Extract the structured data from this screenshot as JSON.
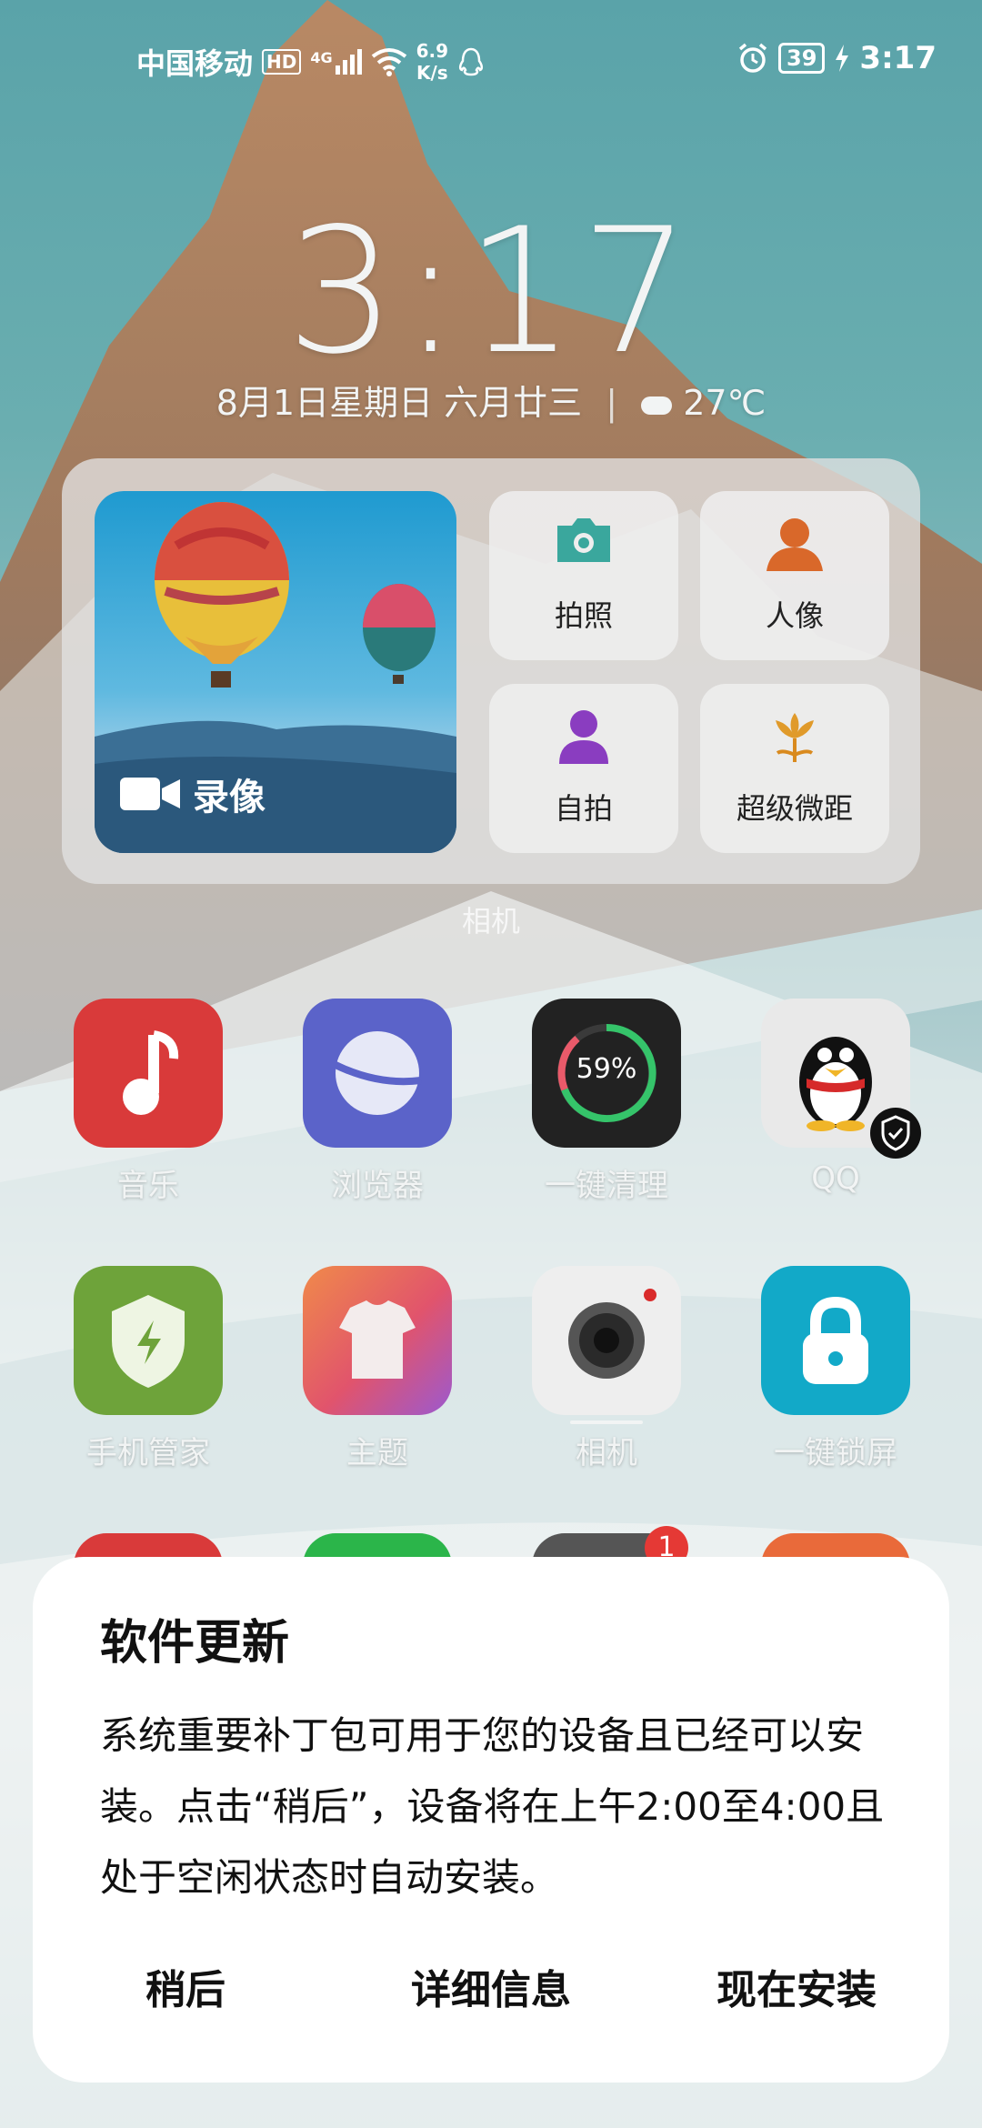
{
  "status_bar": {
    "carrier": "中国移动",
    "hd_badge": "HD",
    "net_type": "4G",
    "net_speed_value": "6.9",
    "net_speed_unit": "K/s",
    "battery": "39",
    "time": "3:17"
  },
  "lockclock": {
    "time": "3:17",
    "date": "8月1日星期日  六月廿三",
    "weather": "27℃"
  },
  "camera_widget": {
    "video_label": "录像",
    "tiles": [
      "拍照",
      "人像",
      "自拍",
      "超级微距"
    ],
    "caption": "相机"
  },
  "apps_row1": [
    "音乐",
    "浏览器",
    "一键清理",
    "QQ"
  ],
  "clean_percent": "59%",
  "apps_row2": [
    "手机管家",
    "主题",
    "相机",
    "一键锁屏"
  ],
  "notification_badge": "1",
  "dialog": {
    "title": "软件更新",
    "message": "系统重要补丁包可用于您的设备且已经可以安装。点击“稍后”，设备将在上午2:00至4:00且处于空闲状态时自动安装。",
    "buttons": [
      "稍后",
      "详细信息",
      "现在安装"
    ]
  },
  "colors": {
    "music": "#d93a3a",
    "browser": "#5b63c9",
    "cleaner": "#222222",
    "qq": "#e9e9e9",
    "manager": "#6ea33a",
    "theme": "#e96a5a",
    "camera_app": "#eeeeee",
    "lock": "#12a9c8"
  }
}
